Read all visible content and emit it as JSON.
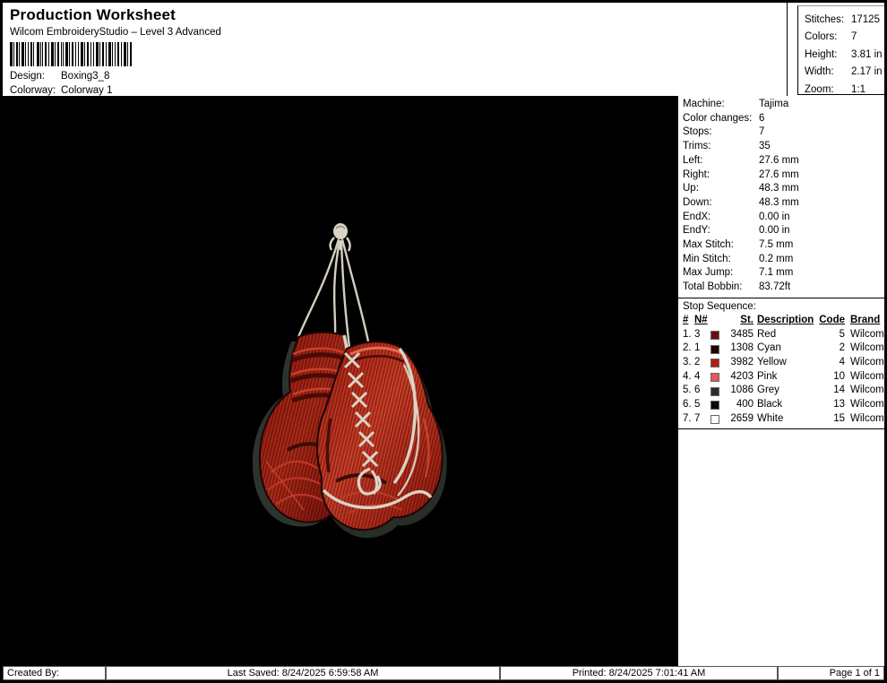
{
  "header": {
    "title": "Production Worksheet",
    "subtitle": "Wilcom EmbroideryStudio – Level 3 Advanced",
    "design_label": "Design:",
    "design_value": "Boxing3_8",
    "colorway_label": "Colorway:",
    "colorway_value": "Colorway 1",
    "stats": [
      {
        "label": "Stitches:",
        "value": "17125"
      },
      {
        "label": "Colors:",
        "value": "7"
      },
      {
        "label": "Height:",
        "value": "3.81 in"
      },
      {
        "label": "Width:",
        "value": "2.17 in"
      },
      {
        "label": "Zoom:",
        "value": "1:1"
      }
    ]
  },
  "canvas": {
    "background": "#000000",
    "design_alt": "Hanging red boxing gloves embroidery"
  },
  "machine_info": [
    {
      "label": "Machine:",
      "value": "Tajima"
    },
    {
      "label": "Color changes:",
      "value": "6"
    },
    {
      "label": "Stops:",
      "value": "7"
    },
    {
      "label": "Trims:",
      "value": "35"
    },
    {
      "label": "Left:",
      "value": "27.6 mm"
    },
    {
      "label": "Right:",
      "value": "27.6 mm"
    },
    {
      "label": "Up:",
      "value": "48.3 mm"
    },
    {
      "label": "Down:",
      "value": "48.3 mm"
    },
    {
      "label": "EndX:",
      "value": "0.00 in"
    },
    {
      "label": "EndY:",
      "value": "0.00 in"
    },
    {
      "label": "Max Stitch:",
      "value": "7.5 mm"
    },
    {
      "label": "Min Stitch:",
      "value": "0.2 mm"
    },
    {
      "label": "Max Jump:",
      "value": "7.1 mm"
    },
    {
      "label": "Total Bobbin:",
      "value": "83.72ft"
    }
  ],
  "stop_sequence": {
    "title": "Stop Sequence:",
    "columns": {
      "num": "#",
      "n": "N#",
      "st": "St.",
      "description": "Description",
      "code": "Code",
      "brand": "Brand"
    },
    "rows": [
      {
        "num": "1.",
        "n": "3",
        "swatch": "#6b0d10",
        "st": "3485",
        "description": "Red",
        "code": "5",
        "brand": "Wilcom"
      },
      {
        "num": "2.",
        "n": "1",
        "swatch": "#1d0305",
        "st": "1308",
        "description": "Cyan",
        "code": "2",
        "brand": "Wilcom"
      },
      {
        "num": "3.",
        "n": "2",
        "swatch": "#b51a1b",
        "st": "3982",
        "description": "Yellow",
        "code": "4",
        "brand": "Wilcom"
      },
      {
        "num": "4.",
        "n": "4",
        "swatch": "#ea5658",
        "st": "4203",
        "description": "Pink",
        "code": "10",
        "brand": "Wilcom"
      },
      {
        "num": "5.",
        "n": "6",
        "swatch": "#2e2d2d",
        "st": "1086",
        "description": "Grey",
        "code": "14",
        "brand": "Wilcom"
      },
      {
        "num": "6.",
        "n": "5",
        "swatch": "#0a0a0a",
        "st": "400",
        "description": "Black",
        "code": "13",
        "brand": "Wilcom"
      },
      {
        "num": "7.",
        "n": "7",
        "swatch": "#ffffff",
        "st": "2659",
        "description": "White",
        "code": "15",
        "brand": "Wilcom"
      }
    ]
  },
  "footer": {
    "created_by": "Created By:",
    "last_saved": "Last Saved: 8/24/2025 6:59:58 AM",
    "printed": "Printed: 8/24/2025 7:01:41 AM",
    "page": "Page 1 of 1"
  }
}
